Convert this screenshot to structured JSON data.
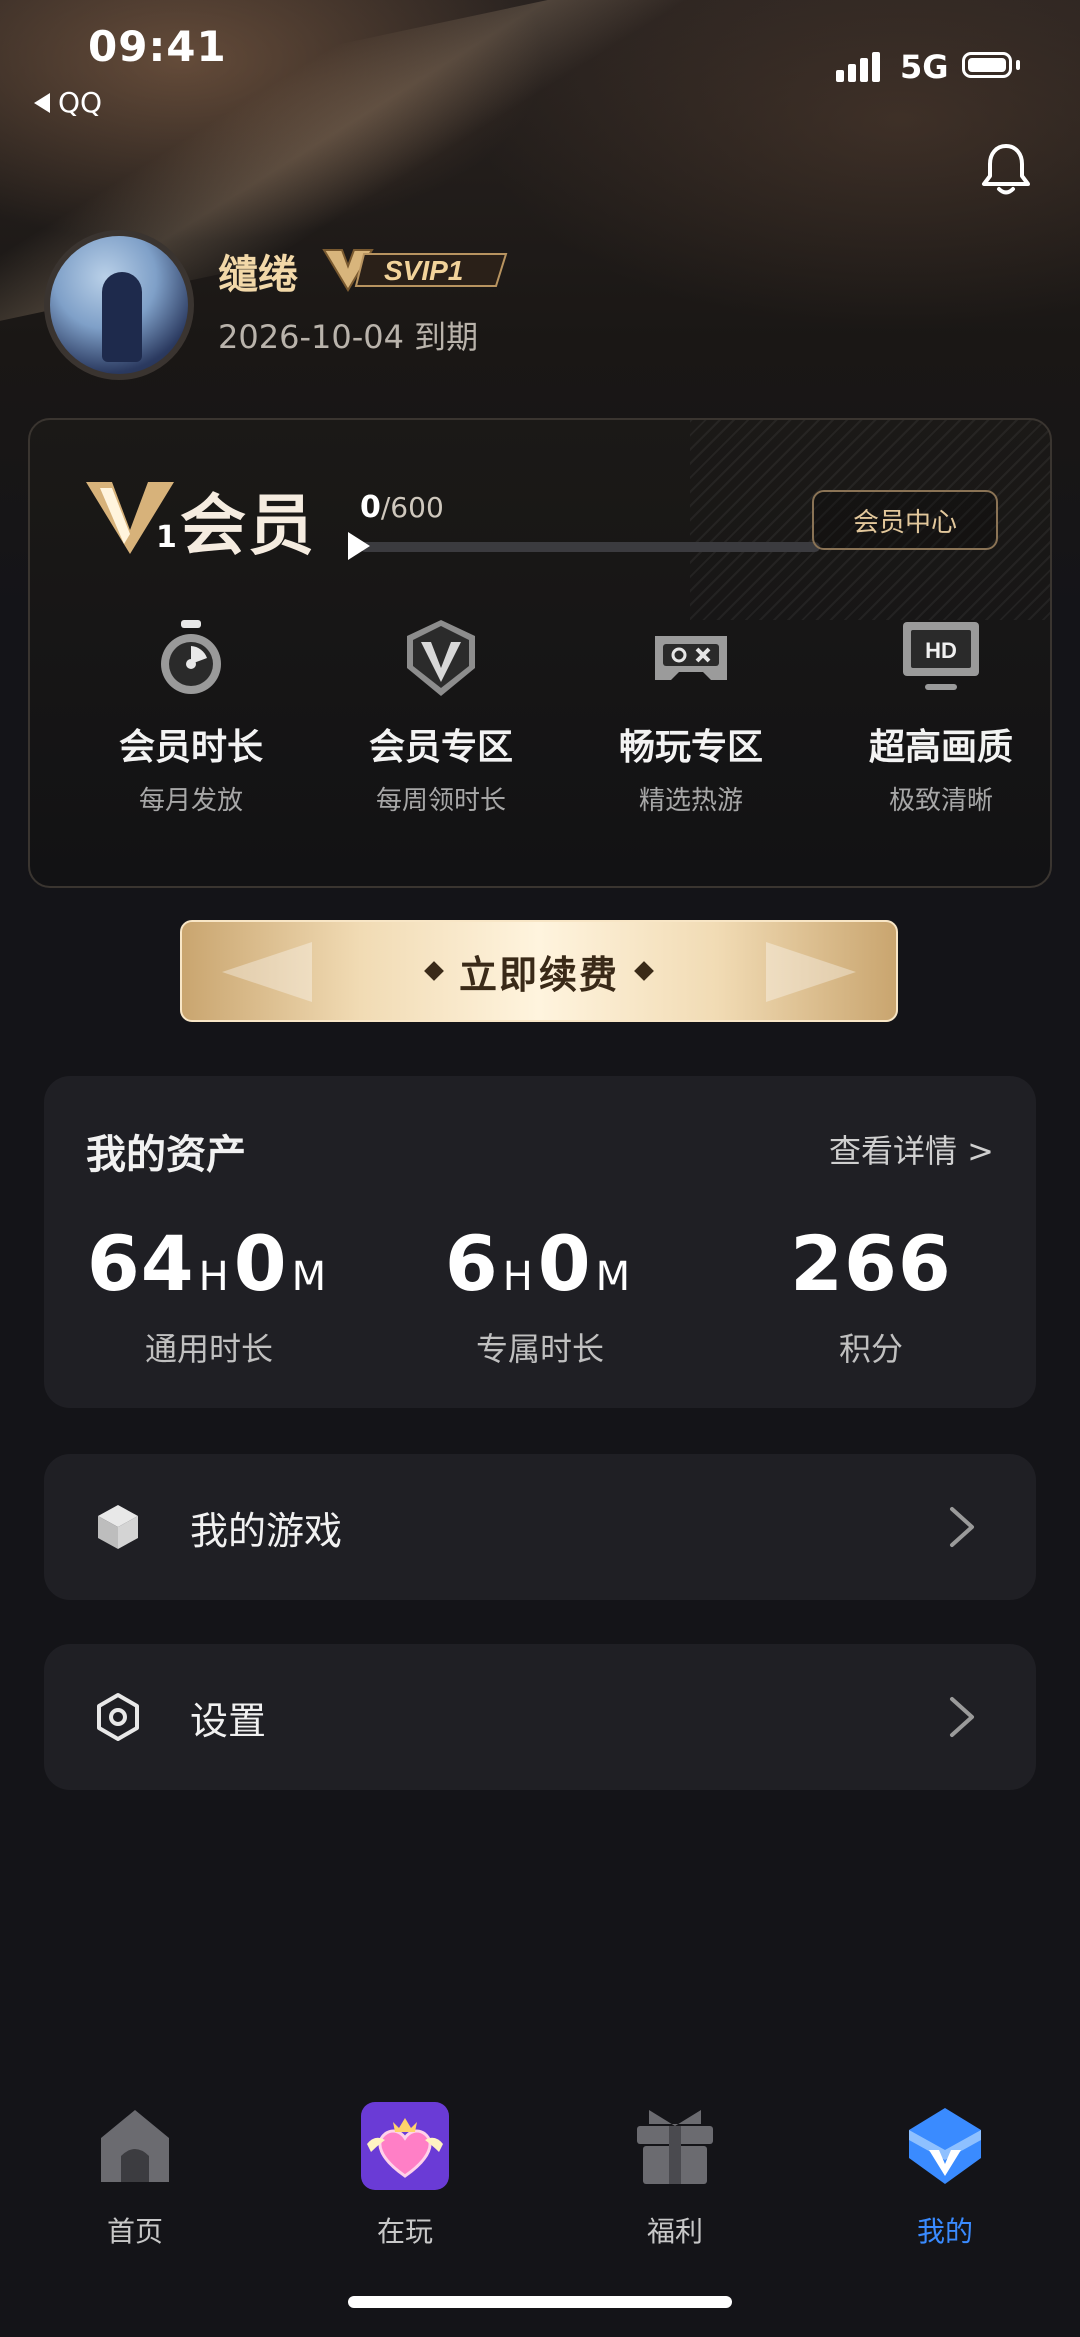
{
  "status_bar": {
    "time": "09:41",
    "back_app": "QQ",
    "network": "5G",
    "icons": [
      "signal-icon",
      "battery-icon"
    ]
  },
  "header": {
    "bell_icon": "bell-icon"
  },
  "profile": {
    "username": "缱绻",
    "badge_text": "SVIP1",
    "expiry": "2026-10-04 到期"
  },
  "member_card": {
    "level_number": "1",
    "title": "会员",
    "progress_current": "0",
    "progress_total": "/600",
    "progress_fraction": 0,
    "center_button": "会员中心",
    "features": [
      {
        "title": "会员时长",
        "subtitle": "每月发放",
        "icon": "stopwatch-icon"
      },
      {
        "title": "会员专区",
        "subtitle": "每周领时长",
        "icon": "v-shield-icon"
      },
      {
        "title": "畅玩专区",
        "subtitle": "精选热游",
        "icon": "gamepad-icon"
      },
      {
        "title": "超高画质",
        "subtitle": "极致清晰",
        "icon": "hd-monitor-icon"
      }
    ]
  },
  "renew_button": "立即续费",
  "assets": {
    "title": "我的资产",
    "detail_link": "查看详情 >",
    "items": [
      {
        "value_h": "64",
        "unit_h": "H",
        "value_m": "0",
        "unit_m": "M",
        "label": "通用时长"
      },
      {
        "value_h": "6",
        "unit_h": "H",
        "value_m": "0",
        "unit_m": "M",
        "label": "专属时长"
      },
      {
        "value": "266",
        "label": "积分"
      }
    ]
  },
  "menu": [
    {
      "label": "我的游戏",
      "icon": "cube-icon"
    },
    {
      "label": "设置",
      "icon": "hexagon-settings-icon"
    }
  ],
  "tabs": [
    {
      "label": "首页",
      "icon": "home-icon",
      "active": false
    },
    {
      "label": "在玩",
      "icon": "heart-crown-icon",
      "active": false
    },
    {
      "label": "福利",
      "icon": "gift-icon",
      "active": false
    },
    {
      "label": "我的",
      "icon": "mine-icon",
      "active": true
    }
  ],
  "colors": {
    "background": "#141418",
    "accent_gold": "#f2d8a8",
    "active_tab": "#3a8bff",
    "card": "#1f1f24"
  }
}
